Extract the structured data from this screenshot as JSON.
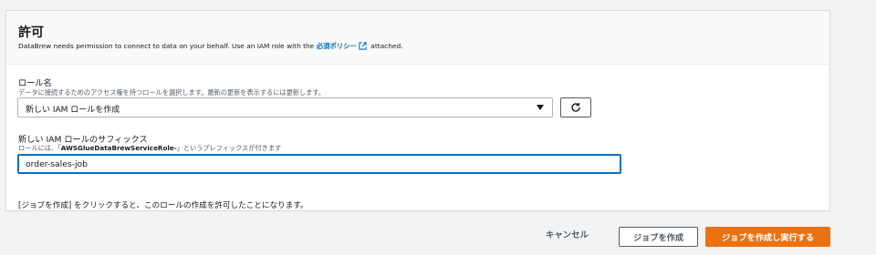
{
  "permissions": {
    "title": "許可",
    "description_prefix": "DataBrew needs permission to connect to data on your behalf. Use an IAM role with the ",
    "policy_link": "必須ポリシー",
    "description_suffix": " attached."
  },
  "role_field": {
    "label": "ロール名",
    "hint": "データに接続するためのアクセス権を持つロールを選択します。最新の更新を表示するには更新します。",
    "selected_value": "新しい IAM ロールを作成"
  },
  "suffix_field": {
    "label": "新しい IAM ロールのサフィックス",
    "hint_prefix": "ロールには、「",
    "hint_prefix_value": "AWSGlueDataBrewServiceRole-",
    "hint_suffix": "」というプレフィックスが付きます",
    "value": "order-sales-job"
  },
  "notice": "[ジョブを作成] をクリックすると、このロールの作成を許可したことになります。",
  "actions": {
    "cancel": "キャンセル",
    "create_job": "ジョブを作成",
    "create_and_run": "ジョブを作成し実行する"
  },
  "colors": {
    "link": "#0073bb",
    "primary": "#ec7211",
    "border": "#aab7b8"
  },
  "icons": {
    "external_link": "external-link-icon",
    "refresh": "refresh-icon",
    "caret": "caret-down-icon"
  }
}
